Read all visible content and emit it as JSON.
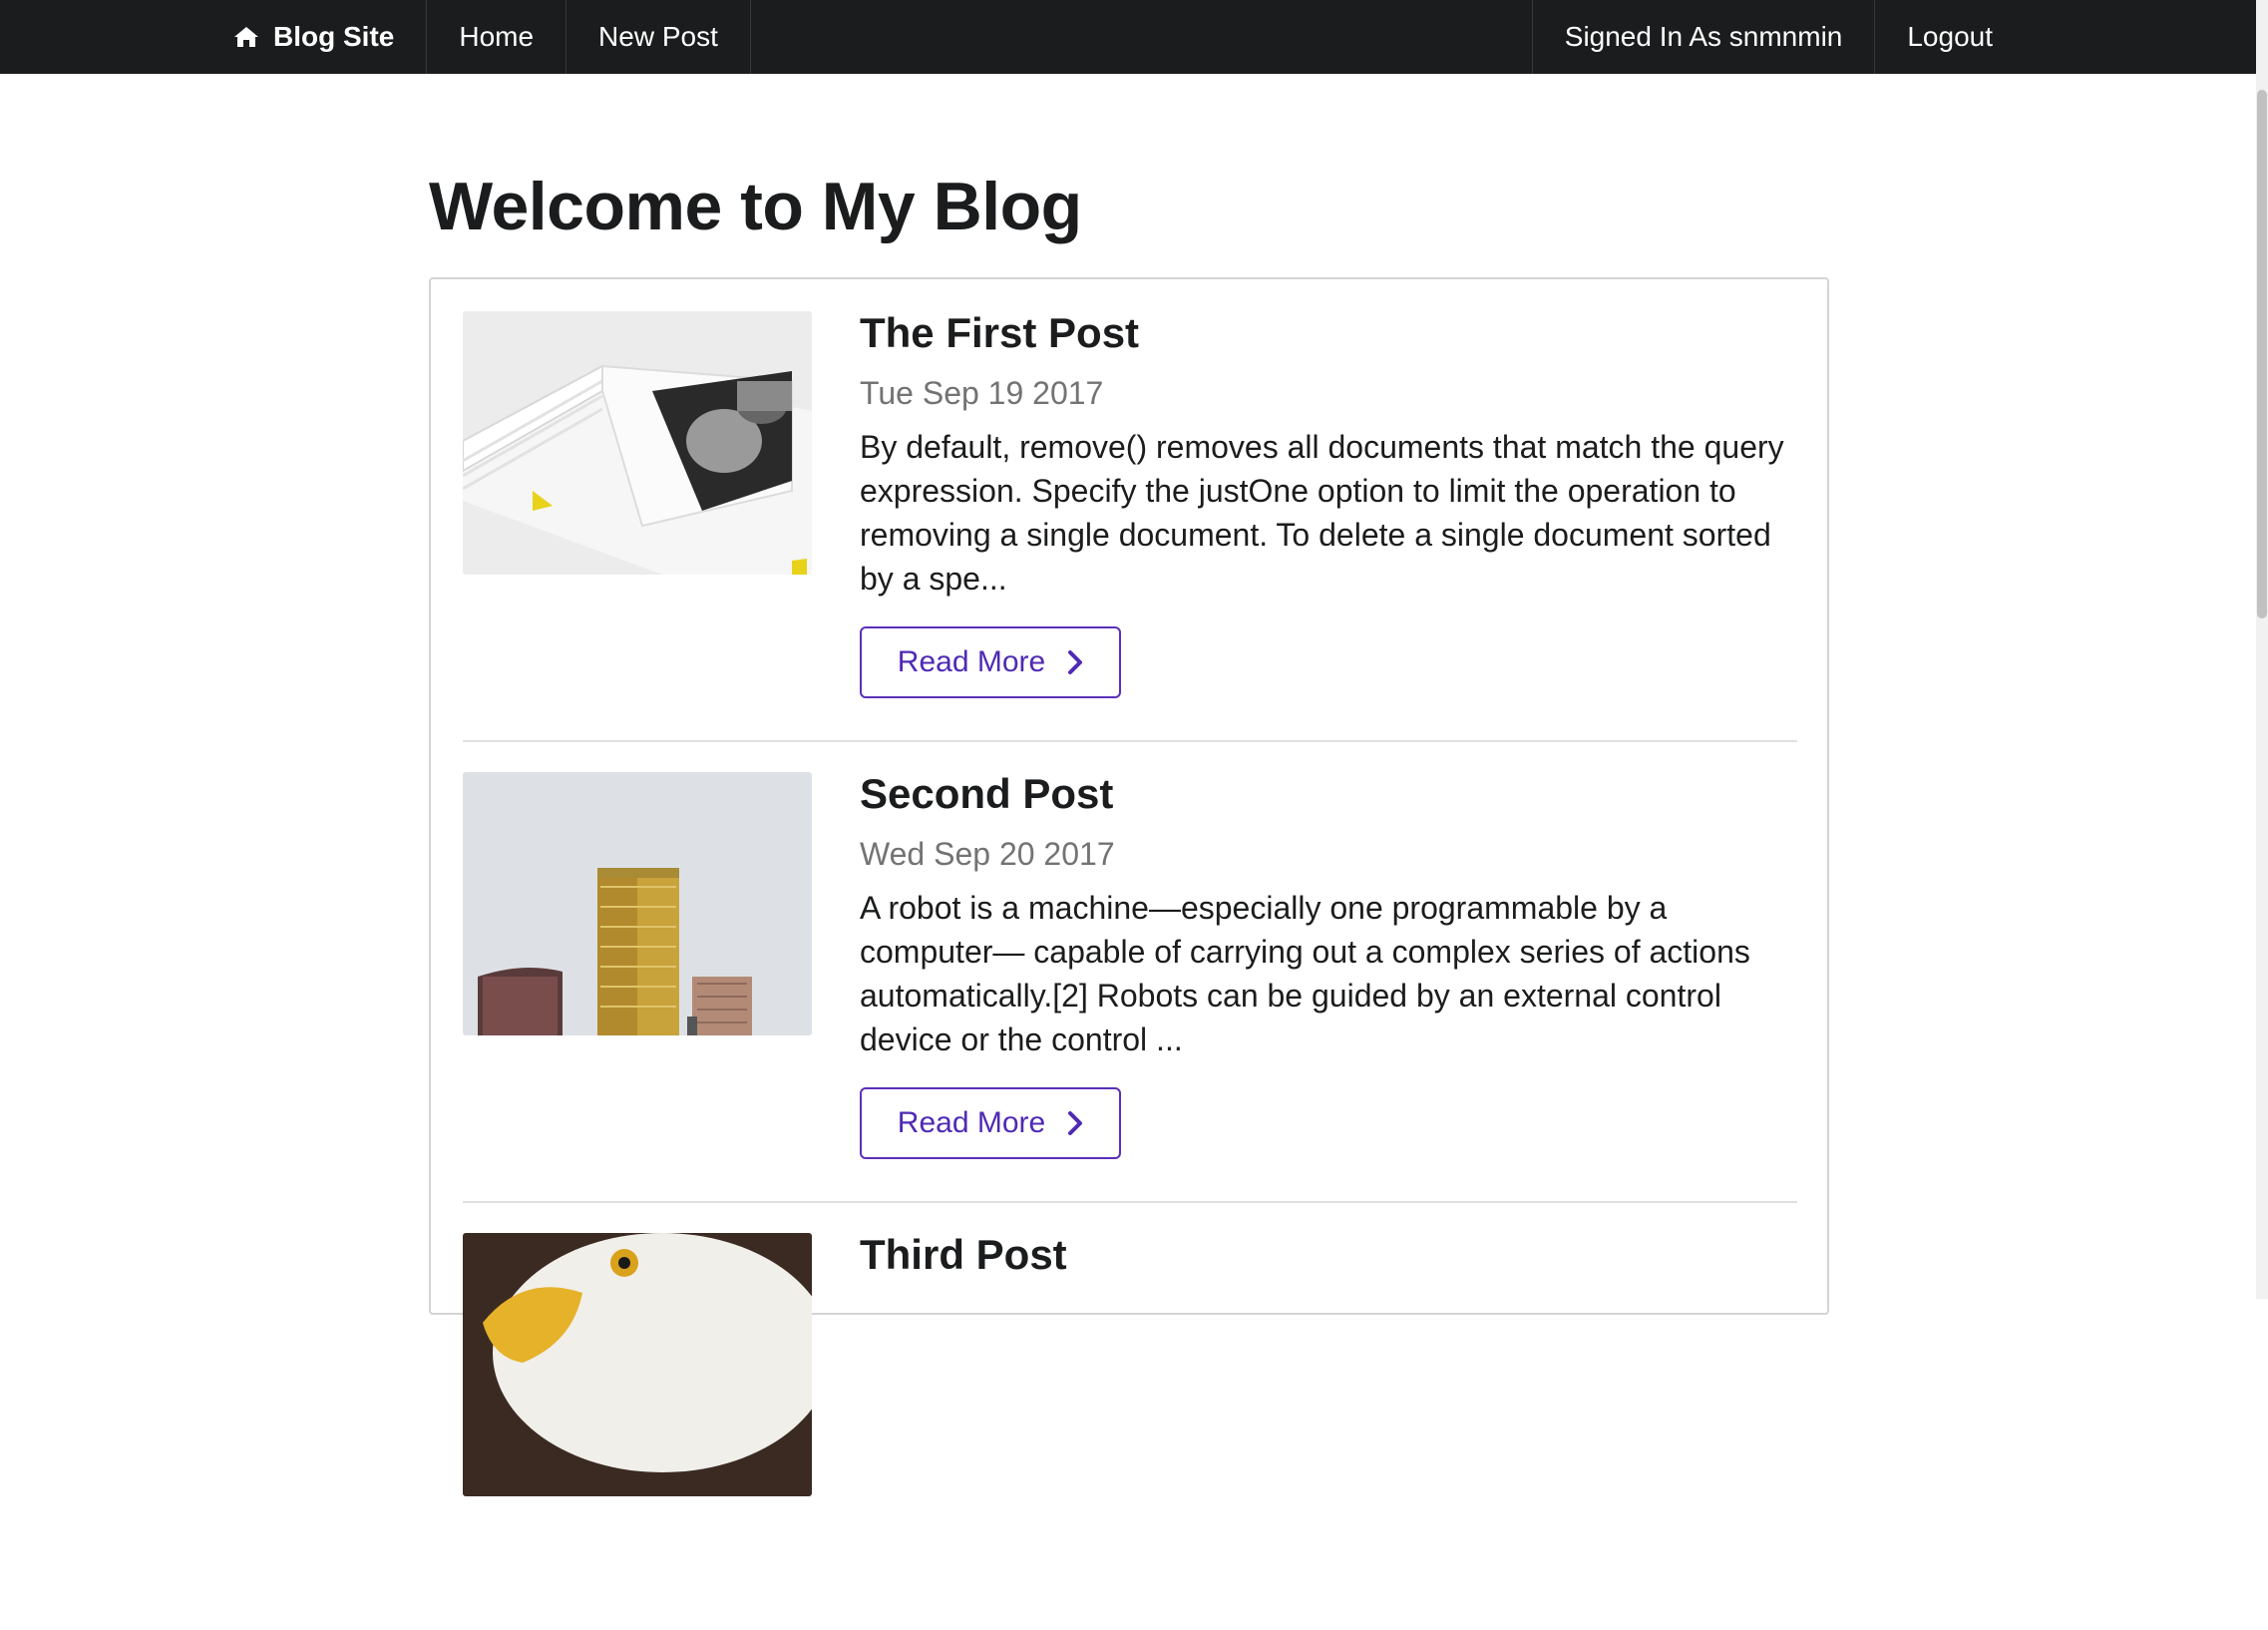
{
  "nav": {
    "brand": "Blog Site",
    "links": [
      "Home",
      "New Post"
    ],
    "signed_in": "Signed In As snmnmin",
    "logout": "Logout"
  },
  "page": {
    "title": "Welcome to My Blog"
  },
  "posts": [
    {
      "title": "The First Post",
      "date": "Tue Sep 19 2017",
      "excerpt": "By default, remove() removes all documents that match the query expression. Specify the justOne option to limit the operation to removing a single document. To delete a single document sorted by a spe...",
      "button": "Read More",
      "thumbnail": "open-book-photo"
    },
    {
      "title": "Second Post",
      "date": "Wed Sep 20 2017",
      "excerpt": "A robot is a machine—especially one programmable by a computer— capable of carrying out a complex series of actions automatically.[2] Robots can be guided by an external control device or the control ...",
      "button": "Read More",
      "thumbnail": "gold-tower-photo"
    },
    {
      "title": "Third Post",
      "thumbnail": "eagle-photo"
    }
  ],
  "colors": {
    "navbar": "#1b1c1d",
    "accent": "#5b2fb8",
    "muted": "#737373"
  },
  "icons": [
    "home-icon",
    "chevron-right-icon"
  ]
}
